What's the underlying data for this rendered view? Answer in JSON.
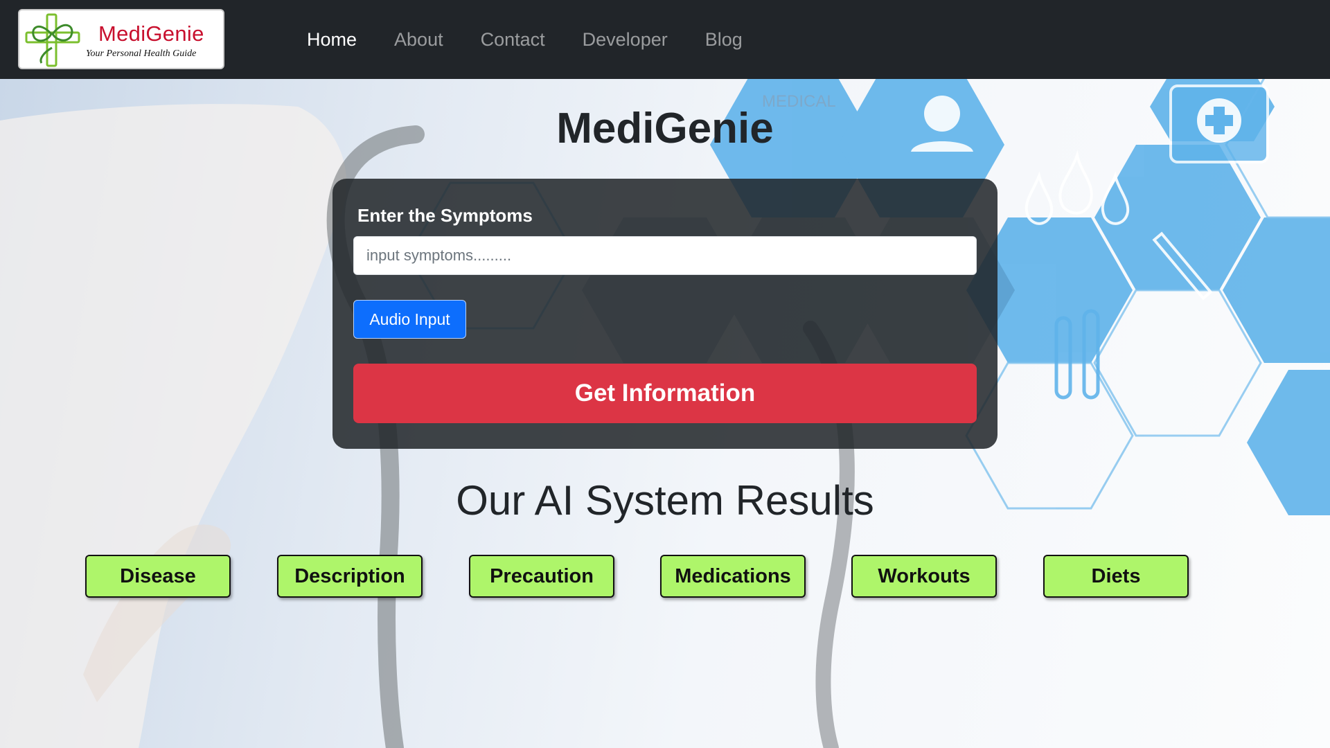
{
  "navbar": {
    "brand": {
      "name": "MediGenie",
      "tagline": "Your Personal Health Guide"
    },
    "links": [
      {
        "label": "Home",
        "active": true
      },
      {
        "label": "About",
        "active": false
      },
      {
        "label": "Contact",
        "active": false
      },
      {
        "label": "Developer",
        "active": false
      },
      {
        "label": "Blog",
        "active": false
      }
    ]
  },
  "hero": {
    "background_text": "MEDICAL",
    "title": "MediGenie"
  },
  "form": {
    "label": "Enter the Symptoms",
    "input_placeholder": "input symptoms.........",
    "input_value": "",
    "audio_button": "Audio Input",
    "submit_button": "Get Information"
  },
  "results": {
    "title": "Our AI System Results",
    "buttons": [
      "Disease",
      "Description",
      "Precaution",
      "Medications",
      "Workouts",
      "Diets"
    ]
  },
  "colors": {
    "navbar_bg": "#212529",
    "brand_red": "#c8102e",
    "primary_blue": "#0d6efd",
    "danger_red": "#dc3545",
    "result_green": "#aef56a",
    "hex_blue": "#5fb3ea"
  }
}
